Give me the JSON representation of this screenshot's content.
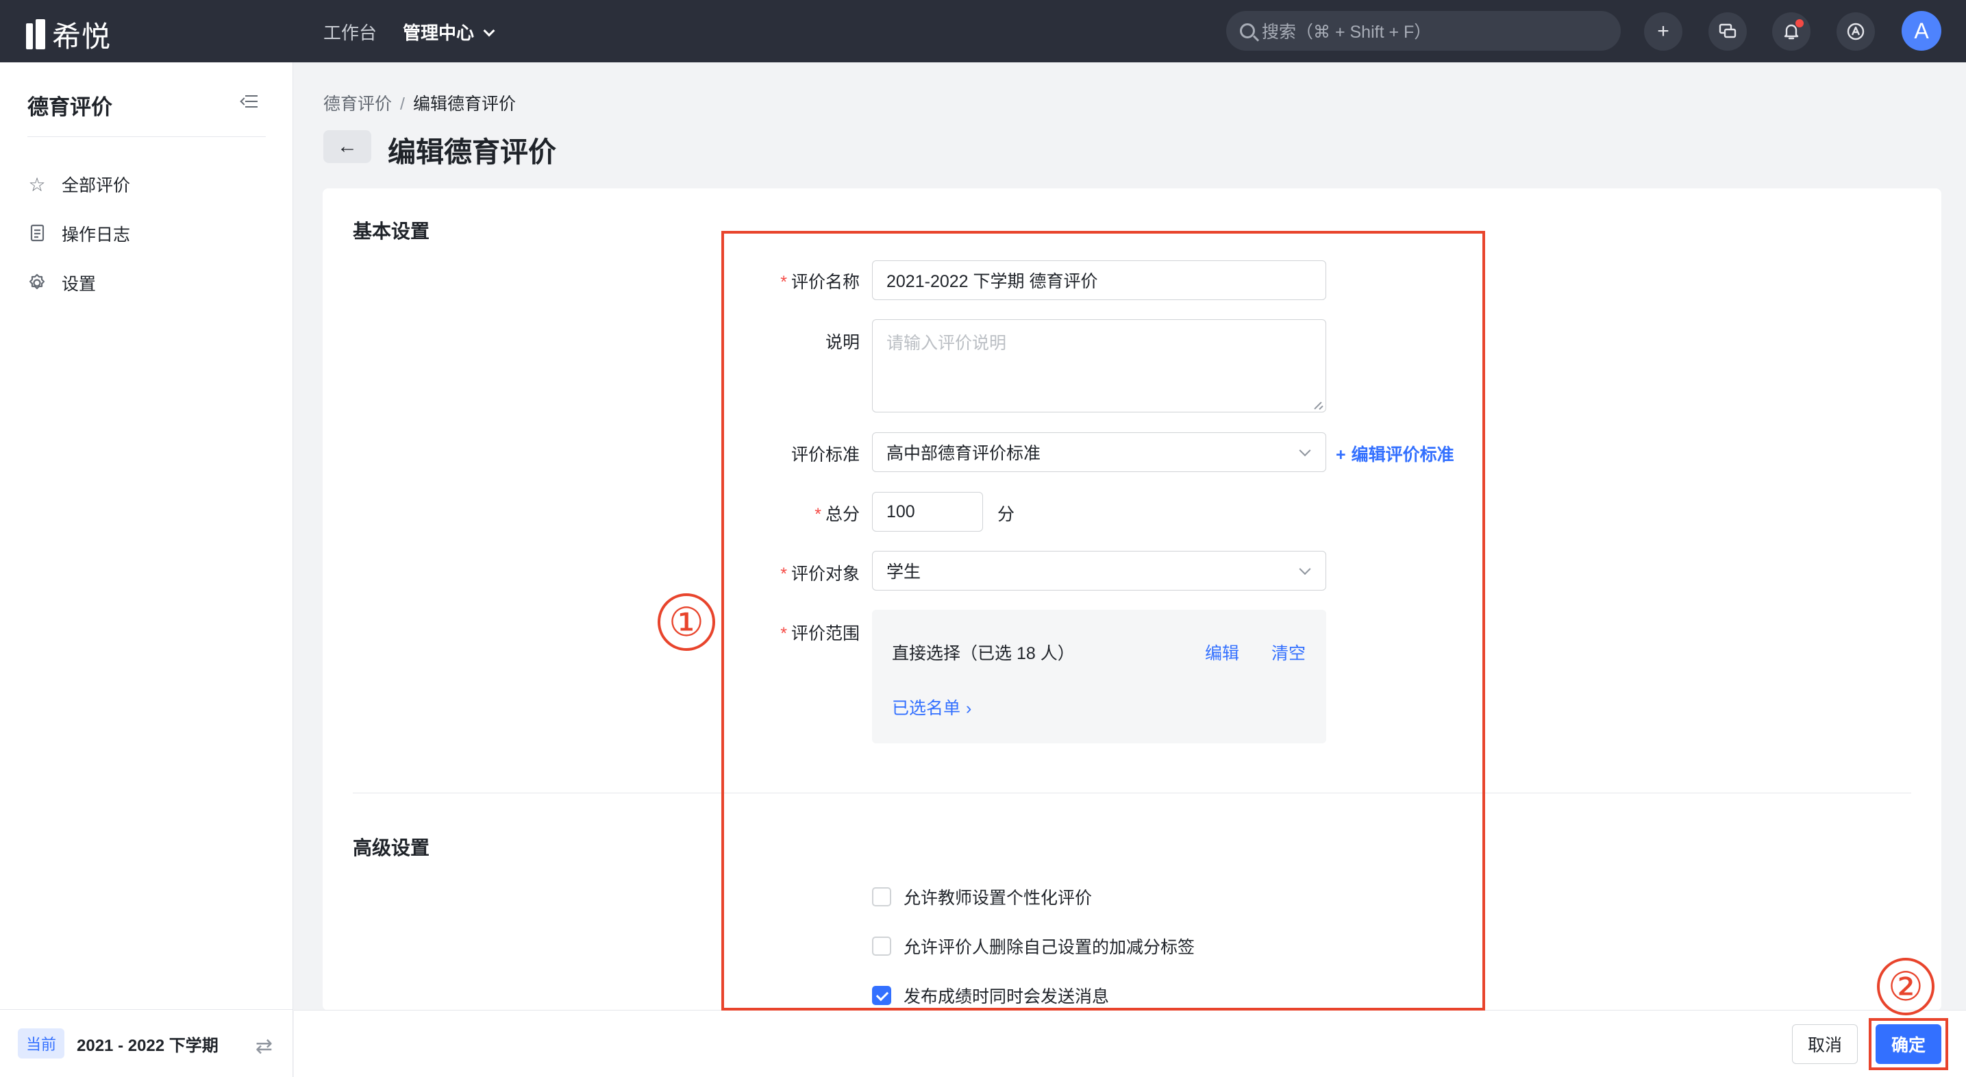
{
  "topbar": {
    "logo_text": "希悦",
    "nav": [
      "工作台",
      "管理中心"
    ],
    "search_placeholder": "搜索（⌘ + Shift + F）",
    "avatar_letter": "A"
  },
  "sidebar": {
    "title": "德育评价",
    "items": [
      {
        "label": "全部评价",
        "icon": "star-icon"
      },
      {
        "label": "操作日志",
        "icon": "document-icon"
      },
      {
        "label": "设置",
        "icon": "gear-icon"
      }
    ],
    "footer": {
      "badge": "当前",
      "term": "2021 - 2022 下学期"
    }
  },
  "breadcrumb": {
    "parent": "德育评价",
    "current": "编辑德育评价"
  },
  "page_title": "编辑德育评价",
  "basic": {
    "section_title": "基本设置",
    "name_label": "评价名称",
    "name_value": "2021-2022 下学期 德育评价",
    "desc_label": "说明",
    "desc_placeholder": "请输入评价说明",
    "standard_label": "评价标准",
    "standard_value": "高中部德育评价标准",
    "edit_standard_link": "编辑评价标准",
    "total_label": "总分",
    "total_value": "100",
    "total_unit": "分",
    "target_label": "评价对象",
    "target_value": "学生",
    "scope_label": "评价范围",
    "scope_text": "直接选择（已选 18 人）",
    "scope_edit": "编辑",
    "scope_clear": "清空",
    "scope_list": "已选名单"
  },
  "advanced": {
    "section_title": "高级设置",
    "options": [
      {
        "label": "允许教师设置个性化评价",
        "checked": false
      },
      {
        "label": "允许评价人删除自己设置的加减分标签",
        "checked": false
      },
      {
        "label": "发布成绩时同时会发送消息",
        "checked": true
      }
    ]
  },
  "footer": {
    "cancel": "取消",
    "ok": "确定"
  },
  "annotations": {
    "one": "①",
    "two": "②",
    "color": "#e8442c"
  },
  "colors": {
    "accent": "#3370ff",
    "topbar": "#2b2f3a",
    "required": "#f54a45"
  }
}
